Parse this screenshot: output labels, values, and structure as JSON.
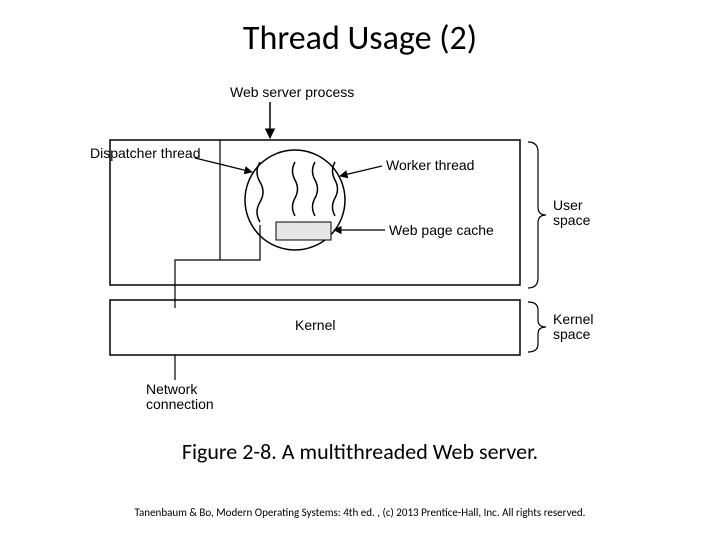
{
  "title": "Thread Usage (2)",
  "labels": {
    "web_server_process": "Web server process",
    "dispatcher_thread": "Dispatcher thread",
    "worker_thread": "Worker thread",
    "web_page_cache": "Web page cache",
    "user_space": "User\nspace",
    "kernel": "Kernel",
    "kernel_space": "Kernel\nspace",
    "network_connection": "Network\nconnection"
  },
  "caption": "Figure 2-8. A multithreaded Web server.",
  "copyright": "Tanenbaum & Bo, Modern Operating Systems: 4th ed. , (c) 2013 Prentice-Hall, Inc. All rights reserved."
}
